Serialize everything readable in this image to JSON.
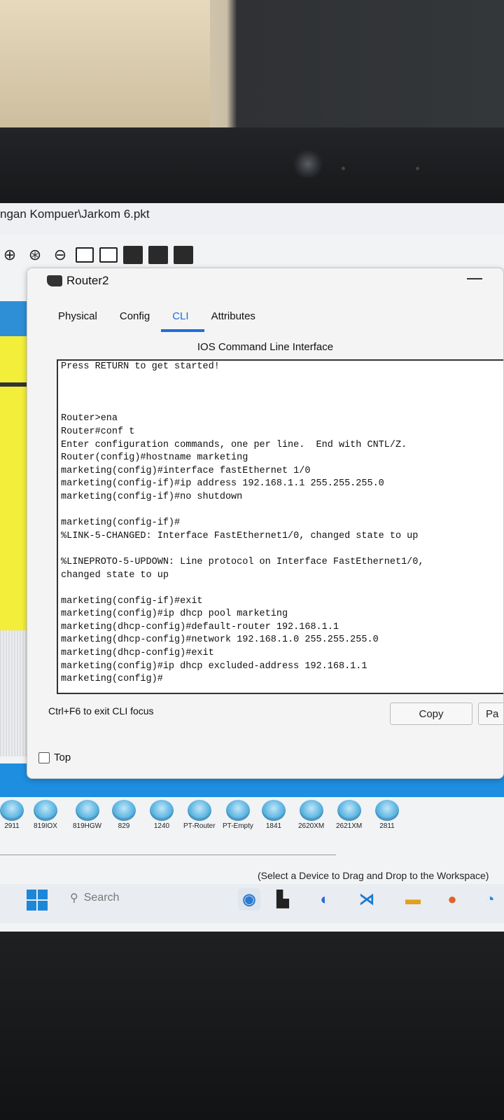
{
  "window": {
    "title": "ngan Kompuer\\Jarkom 6.pkt"
  },
  "dialog": {
    "title": "Router2",
    "tabs": [
      {
        "label": "Physical"
      },
      {
        "label": "Config"
      },
      {
        "label": "CLI"
      },
      {
        "label": "Attributes"
      }
    ],
    "active_tab": "CLI",
    "heading": "IOS Command Line Interface",
    "terminal_lines": [
      "Press RETURN to get started!",
      "",
      "",
      "",
      "Router>ena",
      "Router#conf t",
      "Enter configuration commands, one per line.  End with CNTL/Z.",
      "Router(config)#hostname marketing",
      "marketing(config)#interface fastEthernet 1/0",
      "marketing(config-if)#ip address 192.168.1.1 255.255.255.0",
      "marketing(config-if)#no shutdown",
      "",
      "marketing(config-if)#",
      "%LINK-5-CHANGED: Interface FastEthernet1/0, changed state to up",
      "",
      "%LINEPROTO-5-UPDOWN: Line protocol on Interface FastEthernet1/0,",
      "changed state to up",
      "",
      "marketing(config-if)#exit",
      "marketing(config)#ip dhcp pool marketing",
      "marketing(dhcp-config)#default-router 192.168.1.1",
      "marketing(dhcp-config)#network 192.168.1.0 255.255.255.0",
      "marketing(dhcp-config)#exit",
      "marketing(config)#ip dhcp excluded-address 192.168.1.1",
      "marketing(config)#"
    ],
    "focus_hint": "Ctrl+F6 to exit CLI focus",
    "copy_label": "Copy",
    "paste_label": "Pa",
    "top_label": "Top"
  },
  "palette": {
    "devices": [
      {
        "label": "2911"
      },
      {
        "label": "819IOX"
      },
      {
        "label": "819HGW"
      },
      {
        "label": "829"
      },
      {
        "label": "1240"
      },
      {
        "label": "PT-Router"
      },
      {
        "label": "PT-Empty"
      },
      {
        "label": "1841"
      },
      {
        "label": "2620XM"
      },
      {
        "label": "2621XM"
      },
      {
        "label": "2811"
      }
    ],
    "hint": "(Select a Device to Drag and Drop to the Workspace)"
  },
  "taskbar": {
    "search_placeholder": "Search"
  }
}
